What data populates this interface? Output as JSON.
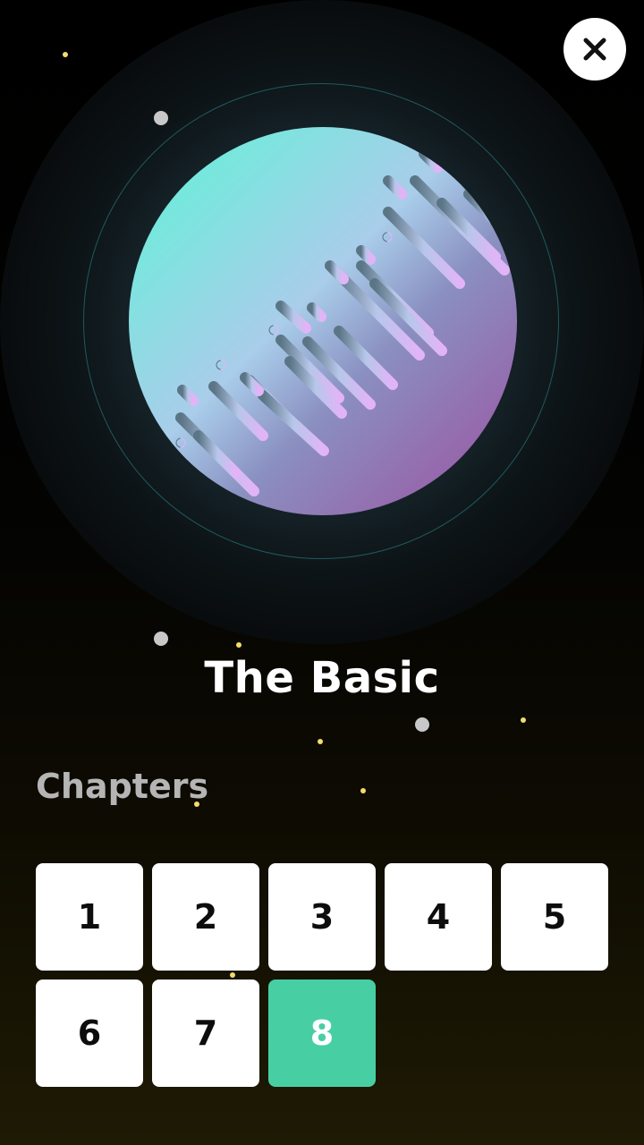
{
  "close_button": {
    "icon": "close-icon"
  },
  "level": {
    "title": "The Basic"
  },
  "chapters": {
    "label": "Chapters",
    "items": [
      {
        "label": "1",
        "active": false
      },
      {
        "label": "2",
        "active": false
      },
      {
        "label": "3",
        "active": false
      },
      {
        "label": "4",
        "active": false
      },
      {
        "label": "5",
        "active": false
      },
      {
        "label": "6",
        "active": false
      },
      {
        "label": "7",
        "active": false
      },
      {
        "label": "8",
        "active": true
      }
    ]
  },
  "colors": {
    "active_chapter": "#47cfa3",
    "chapter_bg": "#ffffff",
    "planet_gradient": [
      "#5cf5d6",
      "#a9cdea",
      "#9d62a8",
      "#d9a8f5"
    ],
    "star": "#f3dc6c"
  }
}
